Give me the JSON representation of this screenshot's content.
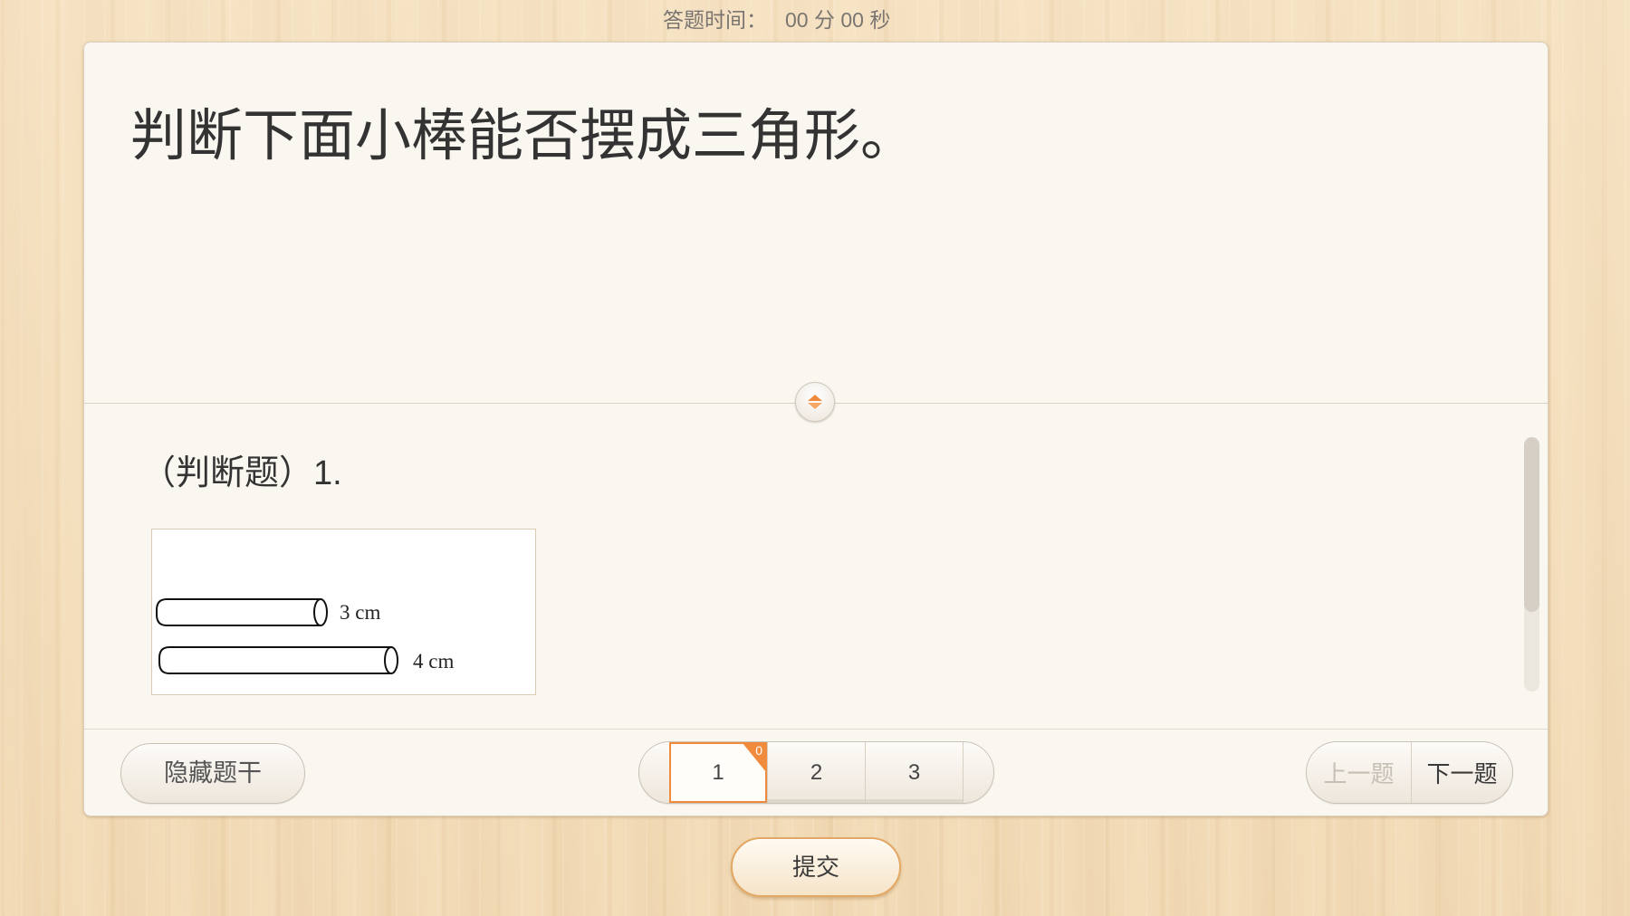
{
  "timer": {
    "label": "答题时间：",
    "value": "00 分 00 秒"
  },
  "question": {
    "stem": "判断下面小棒能否摆成三角形。",
    "subtitle": "（判断题）1."
  },
  "figure": {
    "sticks": [
      {
        "label": "3 cm"
      },
      {
        "label": "4 cm"
      }
    ]
  },
  "footer": {
    "hide_stem_label": "隐藏题干",
    "pages": [
      {
        "label": "1",
        "active": true,
        "badge": "0"
      },
      {
        "label": "2",
        "active": false
      },
      {
        "label": "3",
        "active": false
      }
    ],
    "prev_label": "上一题",
    "prev_enabled": false,
    "next_label": "下一题"
  },
  "submit_label": "提交",
  "icons": {
    "toggle": "up-down-arrow-icon"
  },
  "colors": {
    "accent": "#f08a3c",
    "submit_border": "#e3a863",
    "card_background": "#faf7f1",
    "wood_background": "#f2dcb8",
    "disabled_text": "#c6bfb4",
    "text": "#333333"
  }
}
